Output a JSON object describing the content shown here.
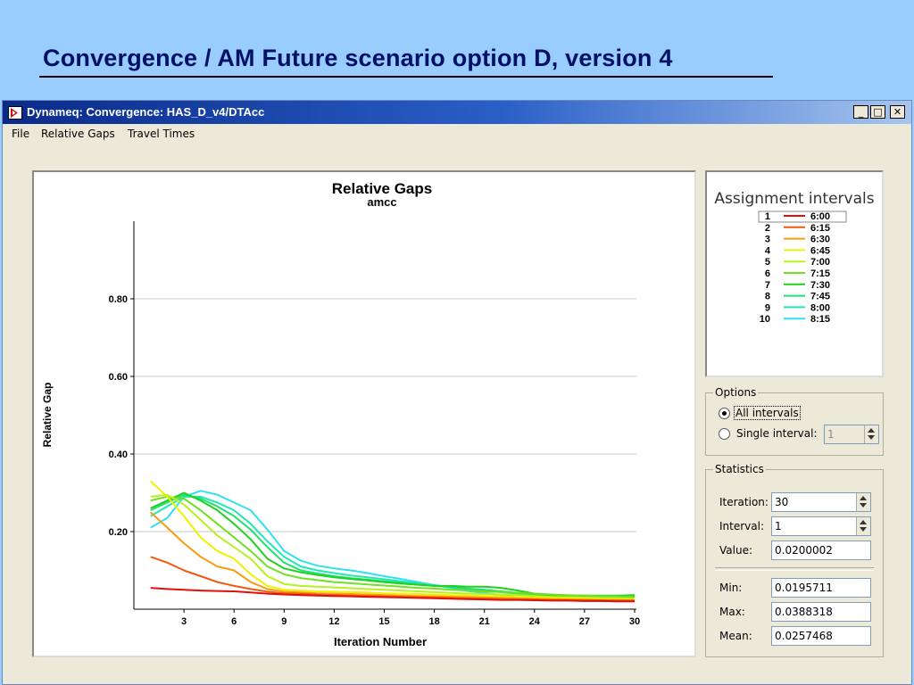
{
  "slide": {
    "title": "Convergence / AM Future scenario option D, version 4"
  },
  "window": {
    "title": "Dynameq: Convergence: HAS_D_v4/DTAcc",
    "controls": {
      "minimize": "_",
      "maximize": "□",
      "close": "✕"
    }
  },
  "menu": [
    "File",
    "Relative Gaps",
    "Travel Times"
  ],
  "legend": {
    "title": "Assignment intervals",
    "items": [
      {
        "num": "1",
        "time": "6:00",
        "color": "#e01010",
        "selected": true
      },
      {
        "num": "2",
        "time": "6:15",
        "color": "#f05a10"
      },
      {
        "num": "3",
        "time": "6:30",
        "color": "#f89c10"
      },
      {
        "num": "4",
        "time": "6:45",
        "color": "#f0f000"
      },
      {
        "num": "5",
        "time": "7:00",
        "color": "#b8f020"
      },
      {
        "num": "6",
        "time": "7:15",
        "color": "#70e020"
      },
      {
        "num": "7",
        "time": "7:30",
        "color": "#20d020"
      },
      {
        "num": "8",
        "time": "7:45",
        "color": "#20e070"
      },
      {
        "num": "9",
        "time": "8:00",
        "color": "#20e8b0"
      },
      {
        "num": "10",
        "time": "8:15",
        "color": "#30e0f0"
      }
    ]
  },
  "options": {
    "label": "Options",
    "all_intervals": "All intervals",
    "single_interval": "Single interval:",
    "single_value": "1",
    "selected": "all"
  },
  "statistics": {
    "label": "Statistics",
    "iteration_label": "Iteration:",
    "iteration_value": "30",
    "interval_label": "Interval:",
    "interval_value": "1",
    "value_label": "Value:",
    "value_value": "0.0200002",
    "min_label": "Min:",
    "min_value": "0.0195711",
    "max_label": "Max:",
    "max_value": "0.0388318",
    "mean_label": "Mean:",
    "mean_value": "0.0257468"
  },
  "chart_data": {
    "type": "line",
    "title": "Relative Gaps",
    "subtitle": "amcc",
    "xlabel": "Iteration Number",
    "ylabel": "Relative Gap",
    "xlim": [
      0,
      30
    ],
    "ylim": [
      0,
      1.0
    ],
    "xticks": [
      3,
      6,
      9,
      12,
      15,
      18,
      21,
      24,
      27,
      30
    ],
    "yticks": [
      0.2,
      0.4,
      0.6,
      0.8
    ],
    "ytick_labels": [
      "0.20",
      "0.40",
      "0.60",
      "0.80"
    ],
    "grid": true,
    "x": [
      1,
      2,
      3,
      4,
      5,
      6,
      7,
      8,
      9,
      10,
      11,
      12,
      13,
      14,
      15,
      16,
      17,
      18,
      19,
      20,
      21,
      22,
      23,
      24,
      25,
      26,
      27,
      28,
      29,
      30
    ],
    "series": [
      {
        "name": "6:00",
        "color": "#e01010",
        "values": [
          0.055,
          0.052,
          0.05,
          0.048,
          0.047,
          0.046,
          0.043,
          0.04,
          0.038,
          0.036,
          0.035,
          0.034,
          0.033,
          0.032,
          0.031,
          0.03,
          0.029,
          0.028,
          0.027,
          0.026,
          0.025,
          0.024,
          0.024,
          0.023,
          0.022,
          0.022,
          0.021,
          0.021,
          0.02,
          0.02
        ]
      },
      {
        "name": "6:15",
        "color": "#f05a10",
        "values": [
          0.135,
          0.12,
          0.1,
          0.085,
          0.07,
          0.06,
          0.052,
          0.045,
          0.041,
          0.04,
          0.038,
          0.036,
          0.035,
          0.034,
          0.033,
          0.032,
          0.031,
          0.03,
          0.029,
          0.028,
          0.027,
          0.026,
          0.025,
          0.025,
          0.024,
          0.024,
          0.023,
          0.023,
          0.022,
          0.022
        ]
      },
      {
        "name": "6:30",
        "color": "#f89c10",
        "values": [
          0.25,
          0.21,
          0.17,
          0.135,
          0.11,
          0.1,
          0.07,
          0.052,
          0.045,
          0.043,
          0.041,
          0.04,
          0.039,
          0.038,
          0.036,
          0.035,
          0.034,
          0.033,
          0.032,
          0.031,
          0.03,
          0.029,
          0.028,
          0.027,
          0.026,
          0.025,
          0.025,
          0.024,
          0.024,
          0.023
        ]
      },
      {
        "name": "6:45",
        "color": "#f0f000",
        "values": [
          0.33,
          0.29,
          0.24,
          0.185,
          0.15,
          0.13,
          0.09,
          0.06,
          0.05,
          0.048,
          0.046,
          0.045,
          0.044,
          0.043,
          0.041,
          0.04,
          0.039,
          0.038,
          0.036,
          0.035,
          0.034,
          0.033,
          0.031,
          0.03,
          0.029,
          0.028,
          0.027,
          0.026,
          0.026,
          0.025
        ]
      },
      {
        "name": "7:00",
        "color": "#b8f020",
        "values": [
          0.29,
          0.295,
          0.27,
          0.23,
          0.19,
          0.16,
          0.13,
          0.085,
          0.065,
          0.06,
          0.058,
          0.056,
          0.054,
          0.052,
          0.05,
          0.048,
          0.046,
          0.044,
          0.042,
          0.04,
          0.039,
          0.038,
          0.036,
          0.034,
          0.032,
          0.031,
          0.03,
          0.029,
          0.028,
          0.027
        ]
      },
      {
        "name": "7:15",
        "color": "#70e020",
        "values": [
          0.28,
          0.29,
          0.285,
          0.255,
          0.22,
          0.185,
          0.15,
          0.11,
          0.09,
          0.08,
          0.075,
          0.07,
          0.067,
          0.064,
          0.061,
          0.058,
          0.055,
          0.053,
          0.05,
          0.048,
          0.046,
          0.044,
          0.042,
          0.04,
          0.038,
          0.036,
          0.035,
          0.034,
          0.033,
          0.032
        ]
      },
      {
        "name": "7:30",
        "color": "#20d020",
        "values": [
          0.26,
          0.28,
          0.3,
          0.28,
          0.255,
          0.22,
          0.18,
          0.13,
          0.105,
          0.095,
          0.088,
          0.082,
          0.078,
          0.074,
          0.07,
          0.066,
          0.063,
          0.06,
          0.06,
          0.058,
          0.058,
          0.055,
          0.048,
          0.04,
          0.035,
          0.035,
          0.035,
          0.035,
          0.035,
          0.036
        ]
      },
      {
        "name": "7:45",
        "color": "#20e070",
        "values": [
          0.255,
          0.275,
          0.295,
          0.285,
          0.265,
          0.24,
          0.205,
          0.16,
          0.12,
          0.1,
          0.092,
          0.085,
          0.08,
          0.076,
          0.072,
          0.068,
          0.064,
          0.06,
          0.057,
          0.053,
          0.05,
          0.046,
          0.042,
          0.038,
          0.034,
          0.032,
          0.032,
          0.033,
          0.034,
          0.034
        ]
      },
      {
        "name": "8:00",
        "color": "#20e8b0",
        "values": [
          0.24,
          0.265,
          0.29,
          0.29,
          0.275,
          0.255,
          0.22,
          0.175,
          0.135,
          0.11,
          0.1,
          0.093,
          0.087,
          0.082,
          0.077,
          0.072,
          0.067,
          0.062,
          0.057,
          0.052,
          0.048,
          0.044,
          0.04,
          0.036,
          0.032,
          0.03,
          0.03,
          0.03,
          0.03,
          0.03
        ]
      },
      {
        "name": "8:15",
        "color": "#30e0f0",
        "values": [
          0.21,
          0.235,
          0.29,
          0.305,
          0.295,
          0.275,
          0.255,
          0.205,
          0.15,
          0.125,
          0.112,
          0.105,
          0.1,
          0.093,
          0.085,
          0.078,
          0.07,
          0.062,
          0.055,
          0.047,
          0.042,
          0.036,
          0.03,
          0.026,
          0.024,
          0.022,
          0.022,
          0.021,
          0.021,
          0.021
        ]
      }
    ]
  }
}
